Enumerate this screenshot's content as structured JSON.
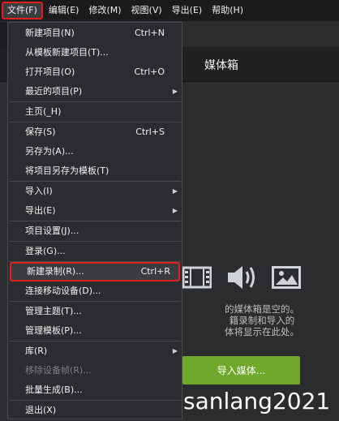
{
  "menubar": {
    "items": [
      "文件(F)",
      "编辑(E)",
      "修改(M)",
      "视图(V)",
      "导出(E)",
      "帮助(H)"
    ]
  },
  "media_bin": {
    "title": "媒体箱",
    "empty_lines": [
      "的媒体箱是空的。",
      "籍录制和导入的",
      "体将显示在此处。"
    ],
    "import_button": "导入媒体..."
  },
  "watermark": "sanlang2021",
  "file_menu": {
    "items": [
      {
        "label": "新建项目(N)",
        "shortcut": "Ctrl+N"
      },
      {
        "label": "从模板新建项目(T)...",
        "shortcut": ""
      },
      {
        "label": "打开项目(O)",
        "shortcut": "Ctrl+O"
      },
      {
        "label": "最近的项目(P)",
        "shortcut": "",
        "submenu": true
      },
      {
        "label": "主页(_H)",
        "shortcut": ""
      },
      {
        "label": "保存(S)",
        "shortcut": "Ctrl+S"
      },
      {
        "label": "另存为(A)...",
        "shortcut": ""
      },
      {
        "label": "将项目另存为模板(T)",
        "shortcut": ""
      },
      {
        "label": "导入(I)",
        "shortcut": "",
        "submenu": true
      },
      {
        "label": "导出(E)",
        "shortcut": "",
        "submenu": true
      },
      {
        "label": "项目设置(J)...",
        "shortcut": ""
      },
      {
        "label": "登录(G)...",
        "shortcut": ""
      },
      {
        "label": "新建录制(R)...",
        "shortcut": "Ctrl+R",
        "highlighted": true
      },
      {
        "label": "连接移动设备(D)...",
        "shortcut": ""
      },
      {
        "label": "管理主题(T)...",
        "shortcut": ""
      },
      {
        "label": "管理模板(P)...",
        "shortcut": ""
      },
      {
        "label": "库(R)",
        "shortcut": "",
        "submenu": true
      },
      {
        "label": "移除设备帧(R)...",
        "shortcut": "",
        "disabled": true
      },
      {
        "label": "批量生成(B)...",
        "shortcut": ""
      },
      {
        "label": "退出(X)",
        "shortcut": ""
      }
    ],
    "submenu_arrow": "▶"
  },
  "icons": [
    "film-icon",
    "audio-icon",
    "image-icon"
  ],
  "colors": {
    "highlight_border": "#e02020",
    "import_button": "#6fa82a"
  }
}
